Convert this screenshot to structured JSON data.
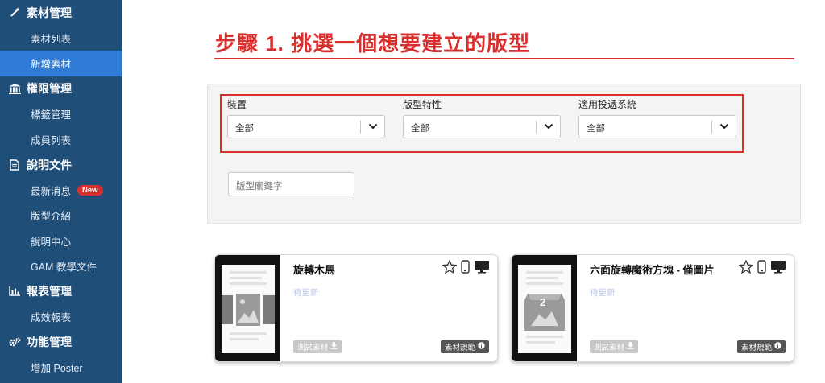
{
  "sidebar": {
    "sections": [
      {
        "label": "素材管理",
        "icon": "magic-wand-icon",
        "items": [
          {
            "label": "素材列表"
          },
          {
            "label": "新增素材",
            "active": true
          }
        ]
      },
      {
        "label": "權限管理",
        "icon": "bank-icon",
        "items": [
          {
            "label": "標籤管理"
          },
          {
            "label": "成員列表"
          }
        ]
      },
      {
        "label": "說明文件",
        "icon": "document-icon",
        "items": [
          {
            "label": "最新消息",
            "badge": "New"
          },
          {
            "label": "版型介紹"
          },
          {
            "label": "說明中心"
          },
          {
            "label": "GAM 教學文件"
          }
        ]
      },
      {
        "label": "報表管理",
        "icon": "bar-chart-icon",
        "items": [
          {
            "label": "成效報表"
          }
        ]
      },
      {
        "label": "功能管理",
        "icon": "gears-icon",
        "items": [
          {
            "label": "增加 Poster"
          }
        ]
      }
    ]
  },
  "main": {
    "title": "步驟 1. 挑選一個想要建立的版型",
    "filters": [
      {
        "label": "裝置",
        "value": "全部"
      },
      {
        "label": "版型特性",
        "value": "全部"
      },
      {
        "label": "適用投遞系統",
        "value": "全部"
      }
    ],
    "keyword_placeholder": "版型關鍵字",
    "cards": [
      {
        "title": "旋轉木馬",
        "status": "待更新",
        "test_label": "測試素材",
        "spec_label": "素材規範"
      },
      {
        "title": "六面旋轉魔術方塊 - 僅圖片",
        "status": "待更新",
        "test_label": "測試素材",
        "spec_label": "素材規範",
        "thumb_number": "2"
      }
    ]
  },
  "colors": {
    "sidebar": "#1f4e79",
    "active": "#2f7cd6",
    "accent": "#d9302e"
  }
}
